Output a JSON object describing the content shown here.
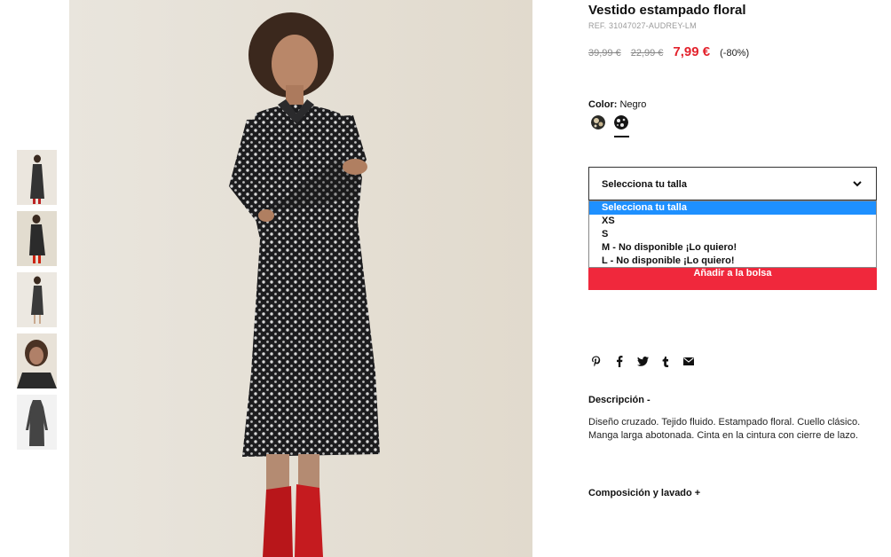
{
  "product": {
    "title": "Vestido estampado floral",
    "ref": "REF. 31047027-AUDREY-LM",
    "price_original": "39,99 €",
    "price_previous": "22,99 €",
    "price_current": "7,99 €",
    "discount": "(-80%)"
  },
  "color": {
    "label": "Color:",
    "value": "Negro",
    "swatches": [
      {
        "name": "color-swatch-floral-light",
        "selected": false
      },
      {
        "name": "color-swatch-negro",
        "selected": true
      }
    ]
  },
  "size_select": {
    "current": "Selecciona tu talla",
    "options": [
      "Selecciona tu talla",
      "XS",
      "S",
      "M - No disponible ¡Lo quiero!",
      "L - No disponible ¡Lo quiero!"
    ],
    "highlighted_index": 0
  },
  "add_to_bag": "Añadir a la bolsa",
  "share_icons": [
    "pinterest-icon",
    "facebook-icon",
    "twitter-icon",
    "tumblr-icon",
    "email-icon"
  ],
  "description": {
    "title": "Descripción  -",
    "body": "Diseño cruzado. Tejido fluido. Estampado floral. Cuello clásico. Manga larga abotonada. Cinta en la cintura con cierre de lazo."
  },
  "composition": {
    "title": "Composición y lavado  +"
  },
  "colors": {
    "accent_red": "#e3232d",
    "button_red": "#f0283c",
    "highlight_blue": "#1e90ff"
  }
}
